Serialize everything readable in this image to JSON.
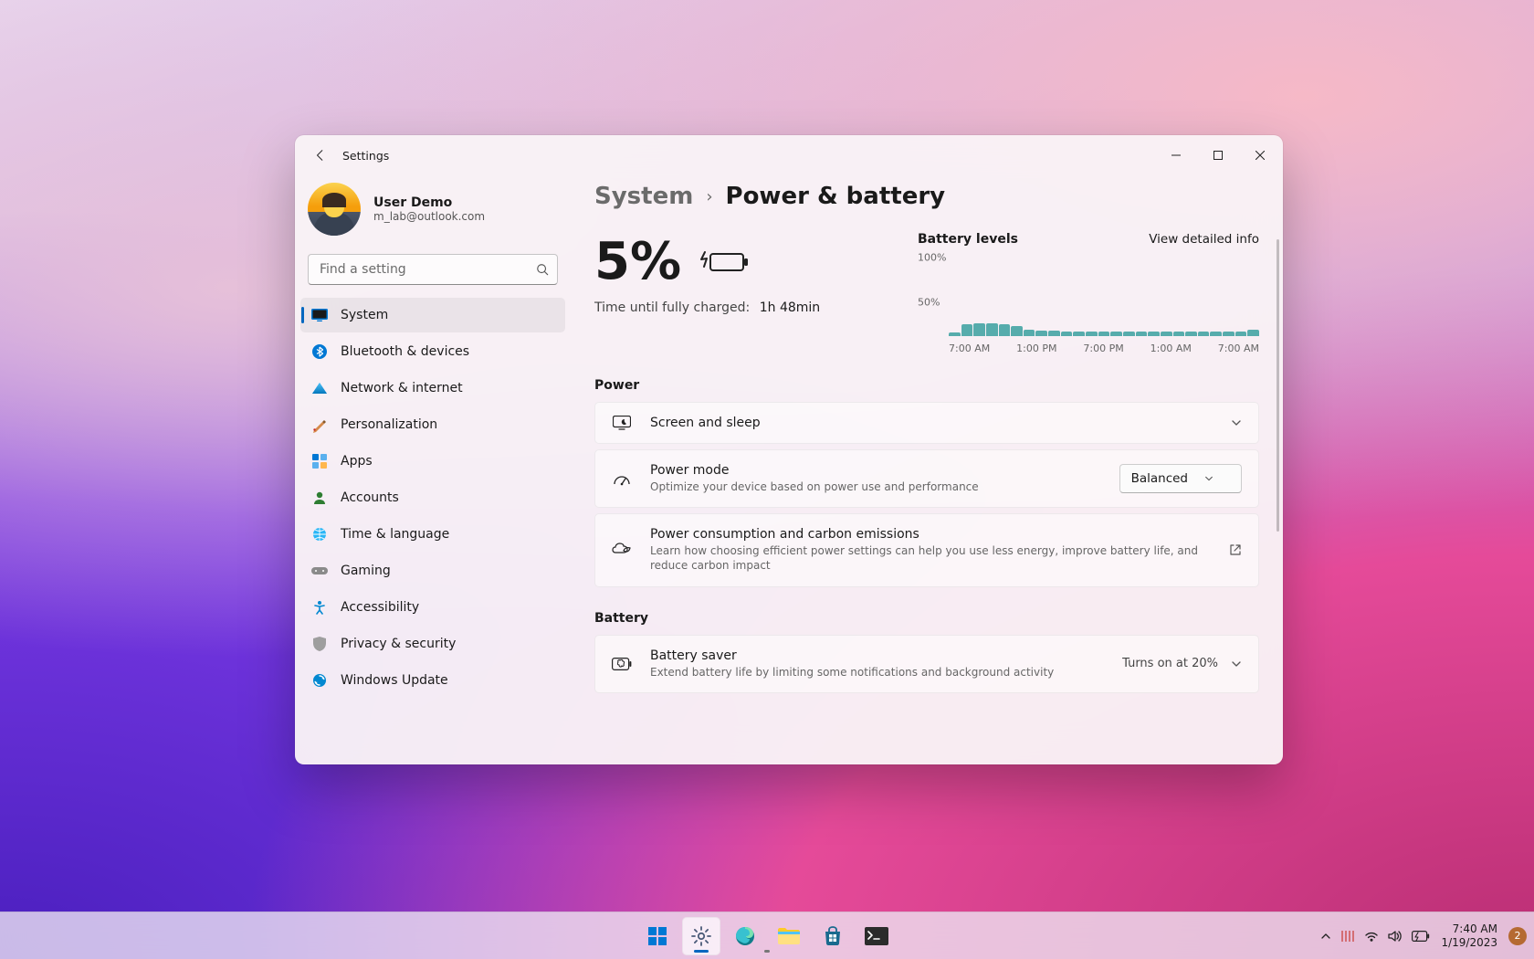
{
  "window": {
    "title": "Settings"
  },
  "user": {
    "name": "User Demo",
    "email": "m_lab@outlook.com"
  },
  "search": {
    "placeholder": "Find a setting"
  },
  "sidebar": {
    "items": [
      {
        "label": "System",
        "active": true
      },
      {
        "label": "Bluetooth & devices"
      },
      {
        "label": "Network & internet"
      },
      {
        "label": "Personalization"
      },
      {
        "label": "Apps"
      },
      {
        "label": "Accounts"
      },
      {
        "label": "Time & language"
      },
      {
        "label": "Gaming"
      },
      {
        "label": "Accessibility"
      },
      {
        "label": "Privacy & security"
      },
      {
        "label": "Windows Update"
      }
    ]
  },
  "breadcrumb": {
    "parent": "System",
    "page": "Power & battery"
  },
  "battery": {
    "percent": "5%",
    "charge_label": "Time until fully charged:",
    "charge_value": "1h 48min"
  },
  "levels": {
    "title": "Battery levels",
    "link": "View detailed info",
    "ylabels": [
      "100%",
      "50%"
    ],
    "xlabels": [
      "7:00 AM",
      "1:00 PM",
      "7:00 PM",
      "1:00 AM",
      "7:00 AM"
    ]
  },
  "sections": {
    "power": "Power",
    "battery": "Battery"
  },
  "cards": {
    "screen": {
      "title": "Screen and sleep"
    },
    "power_mode": {
      "title": "Power mode",
      "sub": "Optimize your device based on power use and performance",
      "value": "Balanced"
    },
    "carbon": {
      "title": "Power consumption and carbon emissions",
      "sub": "Learn how choosing efficient power settings can help you use less energy, improve battery life, and reduce carbon impact"
    },
    "saver": {
      "title": "Battery saver",
      "sub": "Extend battery life by limiting some notifications and background activity",
      "status": "Turns on at 20%"
    }
  },
  "taskbar": {
    "time": "7:40 AM",
    "date": "1/19/2023",
    "notif_count": "2"
  },
  "chart_data": {
    "type": "bar",
    "title": "Battery levels",
    "xlabel": "",
    "ylabel": "",
    "ylim": [
      0,
      100
    ],
    "categories": [
      "7:00 AM",
      "",
      "",
      "",
      "",
      "",
      "1:00 PM",
      "",
      "",
      "",
      "",
      "",
      "7:00 PM",
      "",
      "",
      "",
      "",
      "",
      "1:00 AM",
      "",
      "",
      "",
      "",
      "",
      "7:00 AM"
    ],
    "values": [
      5,
      14,
      16,
      16,
      14,
      12,
      8,
      7,
      7,
      6,
      6,
      6,
      6,
      6,
      6,
      6,
      6,
      6,
      6,
      6,
      6,
      6,
      6,
      6,
      8
    ],
    "x_ticks": [
      "7:00 AM",
      "1:00 PM",
      "7:00 PM",
      "1:00 AM",
      "7:00 AM"
    ],
    "y_ticks": [
      50,
      100
    ]
  }
}
